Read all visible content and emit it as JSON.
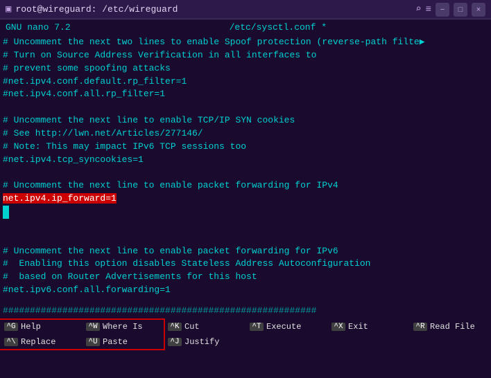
{
  "titlebar": {
    "icon": "▣",
    "title": "root@wireguard: /etc/wireguard",
    "search_icon": "🔍",
    "menu_icon": "☰",
    "minimize": "−",
    "maximize": "□",
    "close": "×"
  },
  "nano_header": {
    "left": "GNU nano 7.2",
    "center": "/etc/sysctl.conf *"
  },
  "editor": {
    "lines": [
      "# Uncomment the next two lines to enable Spoof protection (reverse-path filte▶",
      "# Turn on Source Address Verification in all interfaces to",
      "# prevent some spoofing attacks",
      "#net.ipv4.conf.default.rp_filter=1",
      "#net.ipv4.conf.all.rp_filter=1",
      "",
      "# Uncomment the next line to enable TCP/IP SYN cookies",
      "# See http://lwn.net/Articles/277146/",
      "# Note: This may impact IPv6 TCP sessions too",
      "#net.ipv4.tcp_syncookies=1",
      "",
      "# Uncomment the next line to enable packet forwarding for IPv4",
      "net.ipv4.ip_forward=1",
      "",
      "",
      "# Uncomment the next line to enable packet forwarding for IPv6",
      "#  Enabling this option disables Stateless Address Autoconfiguration",
      "#  based on Router Advertisements for this host",
      "#net.ipv6.conf.all.forwarding=1"
    ],
    "highlighted_line_index": 12,
    "highlighted_text": "net.ipv4.ip_forward=1"
  },
  "hash_line": "##########################################################",
  "shortcuts": [
    {
      "key": "^G",
      "label": "Help"
    },
    {
      "key": "^W",
      "label": "Where Is"
    },
    {
      "key": "^K",
      "label": "Cut"
    },
    {
      "key": "^T",
      "label": "Execute"
    },
    {
      "key": "^X",
      "label": "Exit"
    },
    {
      "key": "^R",
      "label": "Read File"
    },
    {
      "key": "^\\",
      "label": "Replace"
    },
    {
      "key": "^U",
      "label": "Paste"
    },
    {
      "key": "^J",
      "label": "Justify"
    }
  ],
  "shortcuts_grid": [
    [
      {
        "key": "^G",
        "label": "Help"
      },
      {
        "key": "^W",
        "label": "Where Is"
      },
      {
        "key": "^K",
        "label": "Cut"
      },
      {
        "key": "^T",
        "label": "Execute"
      }
    ],
    [
      {
        "key": "^X",
        "label": "Exit"
      },
      {
        "key": "^R",
        "label": "Read File"
      },
      {
        "key": "^\\",
        "label": "Replace"
      },
      {
        "key": "^U",
        "label": "Paste"
      },
      {
        "key": "^J",
        "label": "Justify"
      }
    ]
  ]
}
